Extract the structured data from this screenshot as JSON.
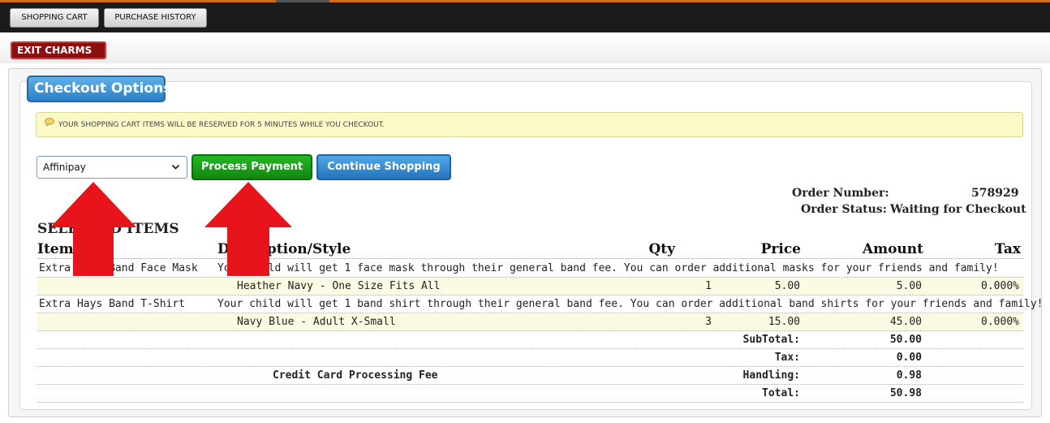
{
  "nav": {
    "tabs": [
      "Shopping Cart",
      "Purchase History"
    ],
    "exit_label": "EXIT CHARMS"
  },
  "panel": {
    "heading": "Checkout Options",
    "notice": "YOUR SHOPPING CART ITEMS WILL BE RESERVED FOR 5 MINUTES WHILE YOU CHECKOUT."
  },
  "payment": {
    "selected": "Affinipay",
    "process_label": "Process Payment",
    "continue_label": "Continue Shopping"
  },
  "order": {
    "number_label": "Order Number:",
    "number": "578929",
    "status_label": "Order Status:",
    "status": "Waiting for Checkout"
  },
  "items": {
    "title": "SELECTED ITEMS",
    "headers": {
      "item": "Item",
      "desc": "Description/Style",
      "qty": "Qty",
      "price": "Price",
      "amount": "Amount",
      "tax": "Tax"
    },
    "rows": [
      {
        "item": "Extra Hays Band Face Mask",
        "desc": "Your child will get 1 face mask through their general band fee. You can order additional masks for your friends and family!"
      },
      {
        "style": "Heather Navy - One Size Fits All",
        "qty": "1",
        "price": "5.00",
        "amount": "5.00",
        "tax": "0.000%"
      },
      {
        "item": "Extra Hays Band T-Shirt",
        "desc": "Your child will get 1 band shirt through their general band fee. You can order additional band shirts for your friends and family!"
      },
      {
        "style": "Navy Blue - Adult X-Small",
        "qty": "3",
        "price": "15.00",
        "amount": "45.00",
        "tax": "0.000%"
      }
    ],
    "totals": {
      "subtotal_label": "SubTotal:",
      "subtotal": "50.00",
      "tax_label": "Tax:",
      "tax": "0.00",
      "fee_desc": "Credit Card Processing Fee",
      "handling_label": "Handling:",
      "handling": "0.98",
      "total_label": "Total:",
      "total": "50.98"
    }
  },
  "colors": {
    "arrow": "#e8141c",
    "process_button": "#14931a",
    "continue_button": "#2f84cc",
    "exit_button": "#8c0f0f"
  }
}
